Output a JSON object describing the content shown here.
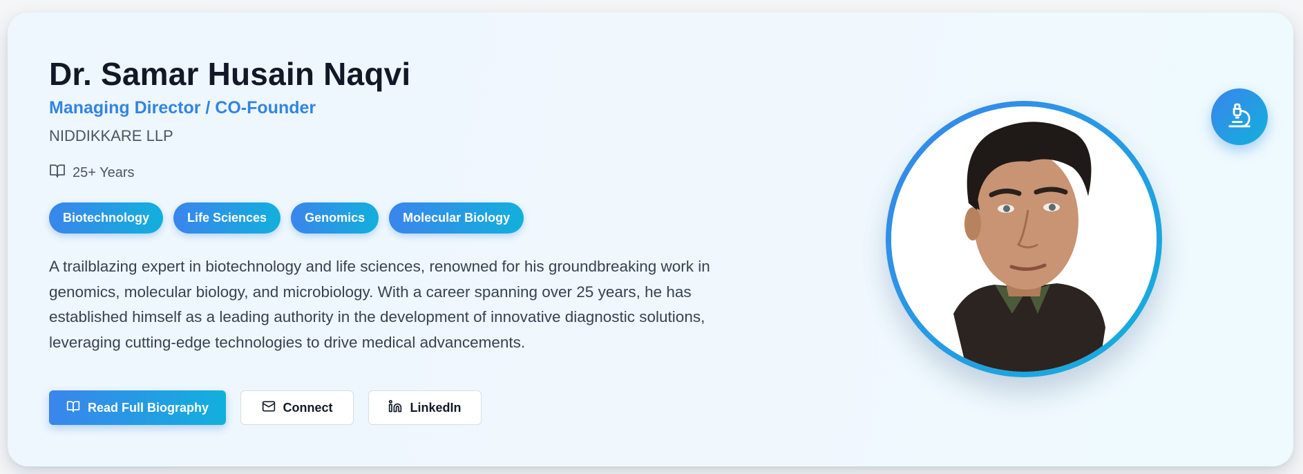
{
  "profile": {
    "name": "Dr. Samar Husain Naqvi",
    "role": "Managing Director / CO-Founder",
    "company": "NIDDIKKARE LLP",
    "experience": "25+ Years",
    "tags": [
      "Biotechnology",
      "Life Sciences",
      "Genomics",
      "Molecular Biology"
    ],
    "bio": "A trailblazing expert in biotechnology and life sciences, renowned for his groundbreaking work in genomics, molecular biology, and microbiology. With a career spanning over 25 years, he has established himself as a leading authority in the development of innovative diagnostic solutions, leveraging cutting-edge technologies to drive medical advancements."
  },
  "actions": {
    "read_bio_label": "Read Full Biography",
    "connect_label": "Connect",
    "linkedin_label": "LinkedIn"
  },
  "icons": {
    "experience": "book-open-icon",
    "read_bio": "book-open-icon",
    "connect": "mail-icon",
    "linkedin": "linkedin-icon",
    "fab": "microscope-icon"
  },
  "colors": {
    "accent": "#3184e4",
    "gradient_start": "#3a85ec",
    "gradient_end": "#12b0dc",
    "heading": "#111827",
    "body_text": "#374151"
  }
}
